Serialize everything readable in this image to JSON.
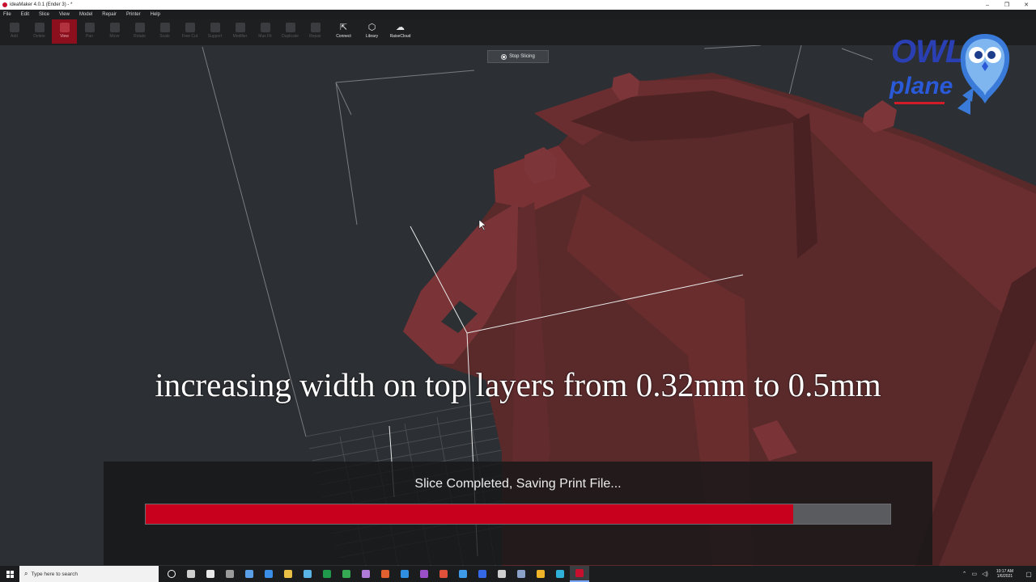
{
  "window": {
    "title": "ideaMaker 4.0.1 (Ender 3) - *",
    "minimize": "–",
    "restore": "❐",
    "close": "✕"
  },
  "menu": [
    "File",
    "Edit",
    "Slice",
    "View",
    "Model",
    "Repair",
    "Printer",
    "Help"
  ],
  "toolbar": {
    "tools": [
      {
        "name": "add",
        "label": "Add"
      },
      {
        "name": "delete",
        "label": "Delete"
      },
      {
        "name": "view",
        "label": "View"
      },
      {
        "name": "pan",
        "label": "Pan"
      },
      {
        "name": "move",
        "label": "Move"
      },
      {
        "name": "rotate",
        "label": "Rotate"
      },
      {
        "name": "scale",
        "label": "Scale"
      },
      {
        "name": "free-cut",
        "label": "Free Cut"
      },
      {
        "name": "support",
        "label": "Support"
      },
      {
        "name": "modifier",
        "label": "Modifier"
      },
      {
        "name": "max-fit",
        "label": "Max Fit"
      },
      {
        "name": "duplicate",
        "label": "Duplicate"
      },
      {
        "name": "repair",
        "label": "Repair"
      }
    ],
    "connect_label": "Connect",
    "library_label": "Library",
    "raisecloud_label": "RaiseCloud"
  },
  "viewport": {
    "stop_label": "Stop Slicing",
    "caption": "increasing width on top layers from 0.32mm to 0.5mm"
  },
  "logo": {
    "line1": "OWL",
    "line2": "plane"
  },
  "progress": {
    "status": "Slice Completed, Saving Print File...",
    "fraction": 0.87,
    "fill_color": "#c8001e"
  },
  "taskbar": {
    "search_placeholder": "Type here to search",
    "time": "10:17 AM",
    "date": "1/6/2021",
    "apps": [
      {
        "name": "cortana",
        "color": "#ffffff"
      },
      {
        "name": "task-view",
        "color": "#cfcfcf"
      },
      {
        "name": "store",
        "color": "#e8e8e8"
      },
      {
        "name": "app-gray",
        "color": "#9a9a9a"
      },
      {
        "name": "pen",
        "color": "#5aa0e6"
      },
      {
        "name": "mail",
        "color": "#3a8ee6"
      },
      {
        "name": "explorer",
        "color": "#e8c046"
      },
      {
        "name": "notepad",
        "color": "#5ab4e6"
      },
      {
        "name": "excel",
        "color": "#1f9a4a"
      },
      {
        "name": "sheets",
        "color": "#35a853"
      },
      {
        "name": "snip",
        "color": "#b07ad8"
      },
      {
        "name": "pdf",
        "color": "#e06030"
      },
      {
        "name": "vscode",
        "color": "#2f8fe0"
      },
      {
        "name": "onenote",
        "color": "#9b4fc7"
      },
      {
        "name": "affinity",
        "color": "#e0503a"
      },
      {
        "name": "sketch",
        "color": "#3d9be9"
      },
      {
        "name": "teams",
        "color": "#3568e6"
      },
      {
        "name": "obs",
        "color": "#cfcfcf"
      },
      {
        "name": "network-app",
        "color": "#8aa2c8"
      },
      {
        "name": "chrome",
        "color": "#f0b429"
      },
      {
        "name": "edge",
        "color": "#2fb0d8"
      },
      {
        "name": "ideamaker",
        "color": "#c8102e"
      }
    ]
  }
}
